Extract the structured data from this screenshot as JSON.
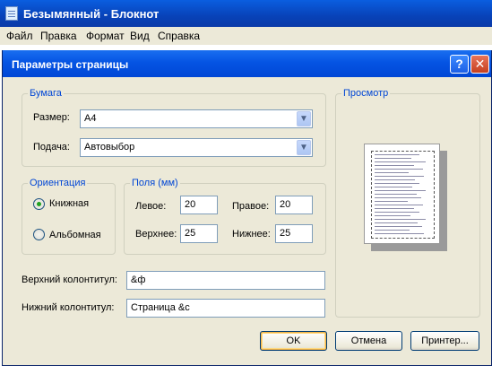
{
  "notepad": {
    "title": "Безымянный - Блокнот",
    "menu": [
      "Файл",
      "Правка",
      "Формат",
      "Вид",
      "Справка"
    ]
  },
  "dialog": {
    "title": "Параметры страницы",
    "help_label": "?",
    "close_label": "✕",
    "paper": {
      "group_label": "Бумага",
      "size_label": "Размер:",
      "size_value": "A4",
      "source_label": "Подача:",
      "source_value": "Автовыбор"
    },
    "orientation": {
      "group_label": "Ориентация",
      "portrait_label": "Книжная",
      "landscape_label": "Альбомная",
      "selected": "portrait"
    },
    "margins": {
      "group_label": "Поля (мм)",
      "left_label": "Левое:",
      "left_value": "20",
      "right_label": "Правое:",
      "right_value": "20",
      "top_label": "Верхнее:",
      "top_value": "25",
      "bottom_label": "Нижнее:",
      "bottom_value": "25"
    },
    "header_label": "Верхний колонтитул:",
    "header_value": "&ф",
    "footer_label": "Нижний колонтитул:",
    "footer_value": "Страница &с",
    "preview_label": "Просмотр",
    "buttons": {
      "ok": "OK",
      "cancel": "Отмена",
      "printer": "Принтер..."
    }
  }
}
